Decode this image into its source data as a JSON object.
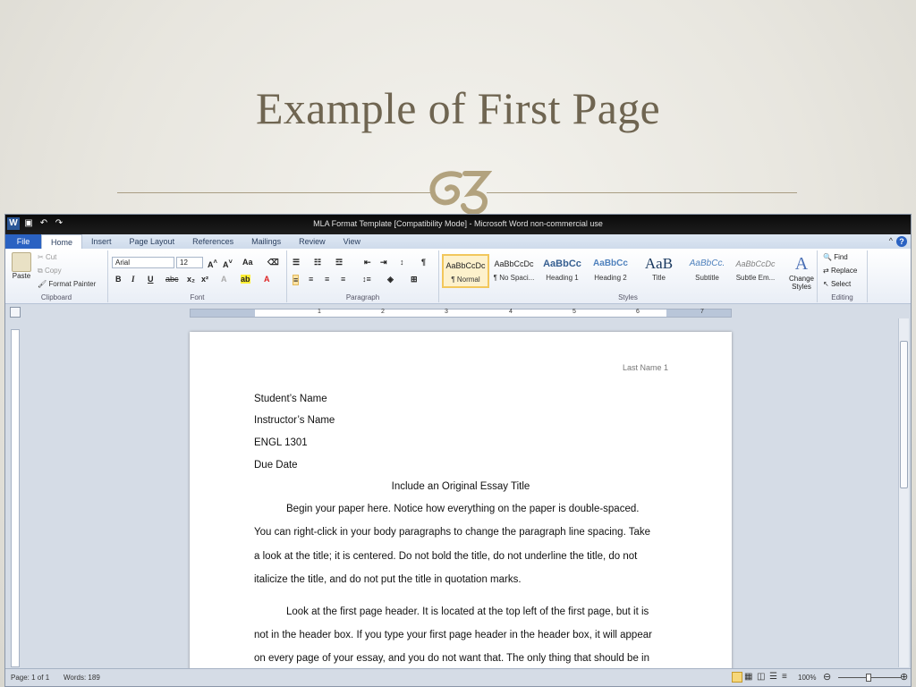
{
  "slide": {
    "title": "Example of First Page"
  },
  "window": {
    "title": "MLA Format Template [Compatibility Mode] - Microsoft Word non-commercial use"
  },
  "tabs": [
    "File",
    "Home",
    "Insert",
    "Page Layout",
    "References",
    "Mailings",
    "Review",
    "View"
  ],
  "ribbon": {
    "clipboard": {
      "paste": "Paste",
      "cut": "Cut",
      "copy": "Copy",
      "format_painter": "Format Painter",
      "label": "Clipboard"
    },
    "font": {
      "name": "Arial",
      "size": "12",
      "bold": "B",
      "italic": "I",
      "underline": "U",
      "label": "Font"
    },
    "paragraph": {
      "label": "Paragraph"
    },
    "styles": {
      "label": "Styles",
      "items": [
        {
          "sample": "AaBbCcDc",
          "name": "¶ Normal"
        },
        {
          "sample": "AaBbCcDc",
          "name": "¶ No Spaci..."
        },
        {
          "sample": "AaBbCc",
          "name": "Heading 1"
        },
        {
          "sample": "AaBbCc",
          "name": "Heading 2"
        },
        {
          "sample": "AaB",
          "name": "Title"
        },
        {
          "sample": "AaBbCc.",
          "name": "Subtitle"
        },
        {
          "sample": "AaBbCcDc",
          "name": "Subtle Em..."
        }
      ],
      "change_styles": "Change Styles"
    },
    "editing": {
      "find": "Find",
      "replace": "Replace",
      "select": "Select",
      "label": "Editing"
    }
  },
  "ruler": {
    "numbers": [
      "1",
      "2",
      "3",
      "4",
      "5",
      "6",
      "7"
    ]
  },
  "document": {
    "header": "Last Name 1",
    "lines": [
      "Student’s Name",
      "Instructor’s Name",
      "ENGL 1301",
      "Due Date",
      "Include an Original Essay Title",
      "Begin your paper here. Notice how everything on the paper is double-spaced.",
      "You can right-click in your body paragraphs to change the paragraph line spacing. Take",
      "a look at the title; it is centered. Do not bold the title, do not underline the title, do not",
      "italicize the title, and do not put the title in quotation marks.",
      "Look at the first page header. It is located at the top left of the first page, but it is",
      "not in the header box. If you type your first page header in the header box, it will appear",
      "on every page of your essay, and you do not want that. The only thing that should be in"
    ]
  },
  "status": {
    "page": "Page: 1 of 1",
    "words": "Words: 189",
    "zoom": "100%"
  }
}
